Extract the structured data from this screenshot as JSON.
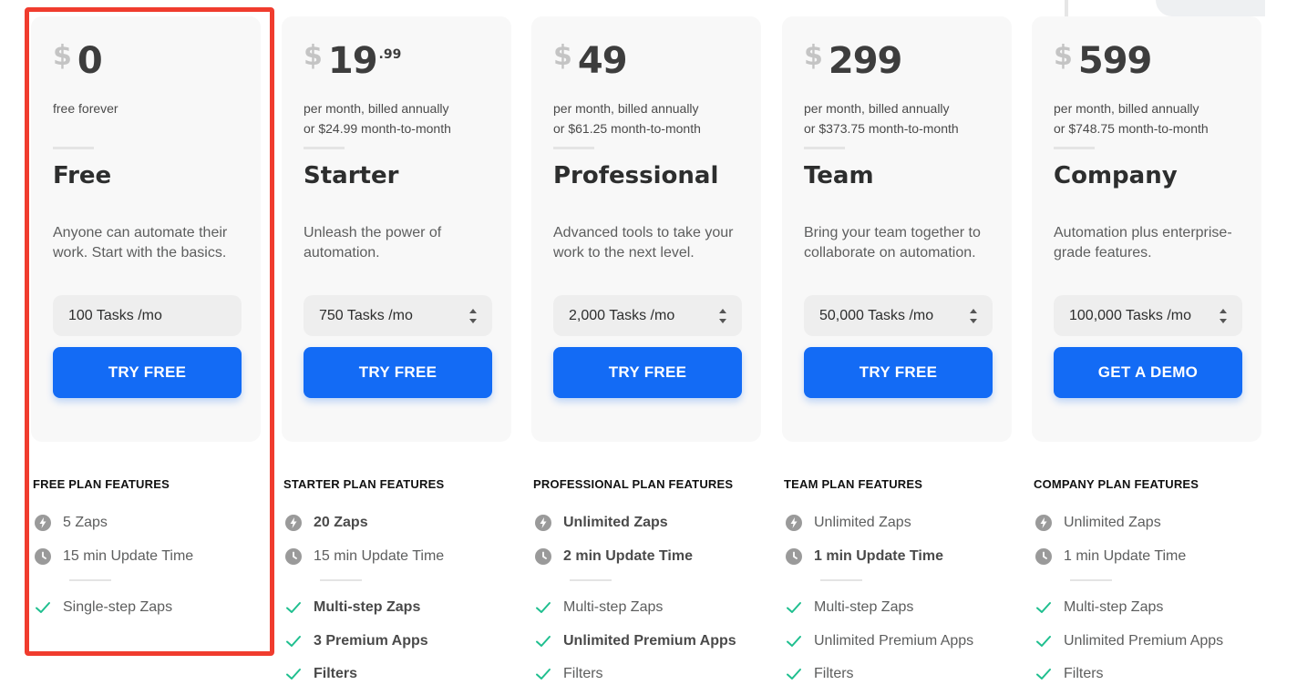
{
  "colors": {
    "accent": "#136bf5",
    "highlight": "#f03c2e",
    "check": "#1fbf8f"
  },
  "plans": [
    {
      "currency": "$",
      "amount": "0",
      "cents": "",
      "billing": [
        "free forever",
        ""
      ],
      "name": "Free",
      "description": "Anyone can automate their work. Start with the basics.",
      "tasks": "100 Tasks /mo",
      "tasks_selectable": false,
      "cta": "TRY FREE",
      "features_title": "FREE PLAN FEATURES",
      "features": [
        {
          "icon": "bolt-icon",
          "text": "5 Zaps",
          "bold": false
        },
        {
          "icon": "clock-icon",
          "text": "15 min Update Time",
          "bold": false
        },
        {
          "icon": "check-icon",
          "text": "Single-step Zaps",
          "bold": false
        }
      ]
    },
    {
      "currency": "$",
      "amount": "19",
      "cents": ".99",
      "billing": [
        "per month, billed annually",
        "or $24.99 month-to-month"
      ],
      "name": "Starter",
      "description": "Unleash the power of automation.",
      "tasks": "750 Tasks /mo",
      "tasks_selectable": true,
      "cta": "TRY FREE",
      "features_title": "STARTER PLAN FEATURES",
      "features": [
        {
          "icon": "bolt-icon",
          "text": "20 Zaps",
          "bold": true
        },
        {
          "icon": "clock-icon",
          "text": "15 min Update Time",
          "bold": false
        },
        {
          "icon": "check-icon",
          "text": "Multi-step Zaps",
          "bold": true
        },
        {
          "icon": "check-icon",
          "text": "3 Premium Apps",
          "bold": true
        },
        {
          "icon": "check-icon",
          "text": "Filters",
          "bold": true
        }
      ]
    },
    {
      "currency": "$",
      "amount": "49",
      "cents": "",
      "billing": [
        "per month, billed annually",
        "or $61.25 month-to-month"
      ],
      "name": "Professional",
      "description": "Advanced tools to take your work to the next level.",
      "tasks": "2,000 Tasks /mo",
      "tasks_selectable": true,
      "cta": "TRY FREE",
      "features_title": "PROFESSIONAL PLAN FEATURES",
      "features": [
        {
          "icon": "bolt-icon",
          "text": "Unlimited Zaps",
          "bold": true
        },
        {
          "icon": "clock-icon",
          "text": "2 min Update Time",
          "bold": true
        },
        {
          "icon": "check-icon",
          "text": "Multi-step Zaps",
          "bold": false
        },
        {
          "icon": "check-icon",
          "text": "Unlimited Premium Apps",
          "bold": true
        },
        {
          "icon": "check-icon",
          "text": "Filters",
          "bold": false
        }
      ]
    },
    {
      "currency": "$",
      "amount": "299",
      "cents": "",
      "billing": [
        "per month, billed annually",
        "or $373.75 month-to-month"
      ],
      "name": "Team",
      "description": "Bring your team together to collaborate on automation.",
      "tasks": "50,000 Tasks /mo",
      "tasks_selectable": true,
      "cta": "TRY FREE",
      "features_title": "TEAM PLAN FEATURES",
      "features": [
        {
          "icon": "bolt-icon",
          "text": "Unlimited Zaps",
          "bold": false
        },
        {
          "icon": "clock-icon",
          "text": "1 min Update Time",
          "bold": true
        },
        {
          "icon": "check-icon",
          "text": "Multi-step Zaps",
          "bold": false
        },
        {
          "icon": "check-icon",
          "text": "Unlimited Premium Apps",
          "bold": false
        },
        {
          "icon": "check-icon",
          "text": "Filters",
          "bold": false
        }
      ]
    },
    {
      "currency": "$",
      "amount": "599",
      "cents": "",
      "billing": [
        "per month, billed annually",
        "or $748.75 month-to-month"
      ],
      "name": "Company",
      "description": "Automation plus enterprise-grade features.",
      "tasks": "100,000 Tasks /mo",
      "tasks_selectable": true,
      "cta": "GET A DEMO",
      "features_title": "COMPANY PLAN FEATURES",
      "features": [
        {
          "icon": "bolt-icon",
          "text": "Unlimited Zaps",
          "bold": false
        },
        {
          "icon": "clock-icon",
          "text": "1 min Update Time",
          "bold": false
        },
        {
          "icon": "check-icon",
          "text": "Multi-step Zaps",
          "bold": false
        },
        {
          "icon": "check-icon",
          "text": "Unlimited Premium Apps",
          "bold": false
        },
        {
          "icon": "check-icon",
          "text": "Filters",
          "bold": false
        }
      ]
    }
  ]
}
